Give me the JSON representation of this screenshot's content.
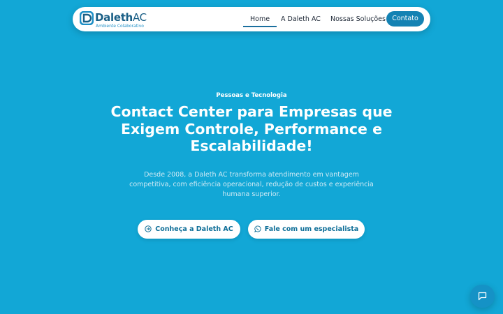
{
  "header": {
    "brand_name": "Daleth",
    "brand_suffix": "AC",
    "brand_tagline": "Ambiente Colaborativo",
    "nav": {
      "home": "Home",
      "about": "A Daleth AC",
      "solutions": "Nossas Soluções",
      "contact": "Contato"
    },
    "active_nav": "home"
  },
  "hero": {
    "eyebrow": "Pessoas e Tecnologia",
    "title": "Contact Center para Empresas que Exigem Controle, Performance e Escalabilidade!",
    "description": "Desde 2008, a Daleth AC transforma atendimento em vantagem competitiva, com eficiência operacional, redução de custos e experiência humana superior.",
    "buttons": {
      "about": "Conheça a Daleth AC",
      "specialist": "Fale com um especialista"
    }
  },
  "icons": {
    "logo": "daleth-logo-icon",
    "about_button": "arrow-circle-right-icon",
    "specialist_button": "whatsapp-icon",
    "chat": "chat-bubble-icon"
  },
  "colors": {
    "background": "#12a7d6",
    "brand": "#1a5f86",
    "accent": "#1482b3",
    "button_text": "#0f6f98"
  }
}
